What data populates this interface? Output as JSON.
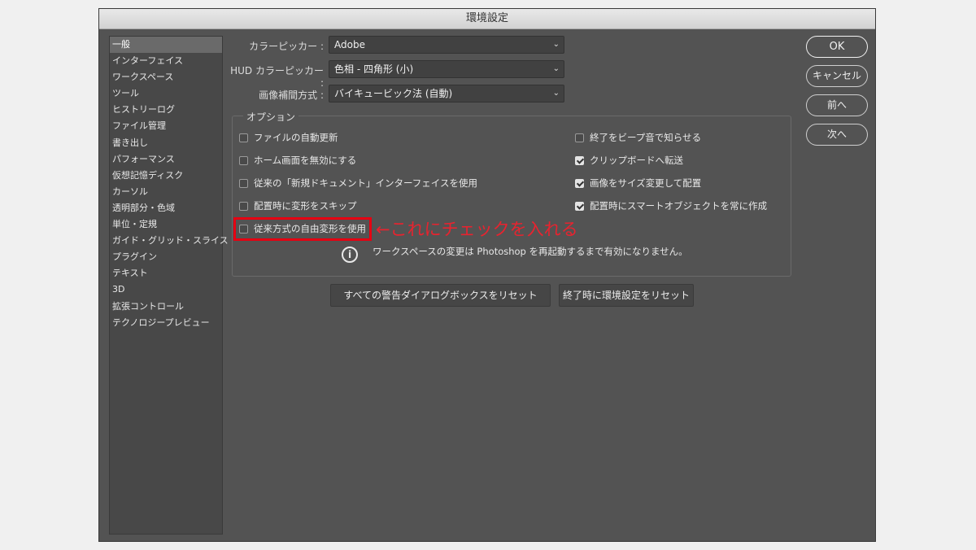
{
  "window": {
    "title": "環境設定"
  },
  "sidebar": {
    "items": [
      {
        "label": "一般",
        "selected": true
      },
      {
        "label": "インターフェイス"
      },
      {
        "label": "ワークスペース"
      },
      {
        "label": "ツール"
      },
      {
        "label": "ヒストリーログ"
      },
      {
        "label": "ファイル管理"
      },
      {
        "label": "書き出し"
      },
      {
        "label": "パフォーマンス"
      },
      {
        "label": "仮想記憶ディスク"
      },
      {
        "label": "カーソル"
      },
      {
        "label": "透明部分・色域"
      },
      {
        "label": "単位・定規"
      },
      {
        "label": "ガイド・グリッド・スライス"
      },
      {
        "label": "プラグイン"
      },
      {
        "label": "テキスト"
      },
      {
        "label": "3D"
      },
      {
        "label": "拡張コントロール"
      },
      {
        "label": "テクノロジープレビュー"
      }
    ]
  },
  "fields": {
    "color_picker": {
      "label": "カラーピッカー :",
      "value": "Adobe"
    },
    "hud_color_picker": {
      "label": "HUD カラーピッカー :",
      "value": "色相 - 四角形 (小)"
    },
    "interpolation": {
      "label": "画像補間方式 :",
      "value": "バイキュービック法 (自動)"
    }
  },
  "options": {
    "title": "オプション",
    "left": [
      {
        "label": "ファイルの自動更新",
        "checked": false
      },
      {
        "label": "ホーム画面を無効にする",
        "checked": false
      },
      {
        "label": "従来の「新規ドキュメント」インターフェイスを使用",
        "checked": false
      },
      {
        "label": "配置時に変形をスキップ",
        "checked": false
      },
      {
        "label": "従来方式の自由変形を使用",
        "checked": false
      }
    ],
    "right": [
      {
        "label": "終了をビープ音で知らせる",
        "checked": false
      },
      {
        "label": "クリップボードへ転送",
        "checked": true
      },
      {
        "label": "画像をサイズ変更して配置",
        "checked": true
      },
      {
        "label": "配置時にスマートオブジェクトを常に作成",
        "checked": true
      }
    ],
    "info": "ワークスペースの変更は Photoshop を再起動するまで有効になりません。"
  },
  "annotation": {
    "text": "←これにチェックを入れる",
    "color": "#e8232f"
  },
  "buttons": {
    "reset_warnings": "すべての警告ダイアログボックスをリセット",
    "reset_on_quit": "終了時に環境設定をリセット",
    "ok": "OK",
    "cancel": "キャンセル",
    "prev": "前へ",
    "next": "次へ"
  }
}
